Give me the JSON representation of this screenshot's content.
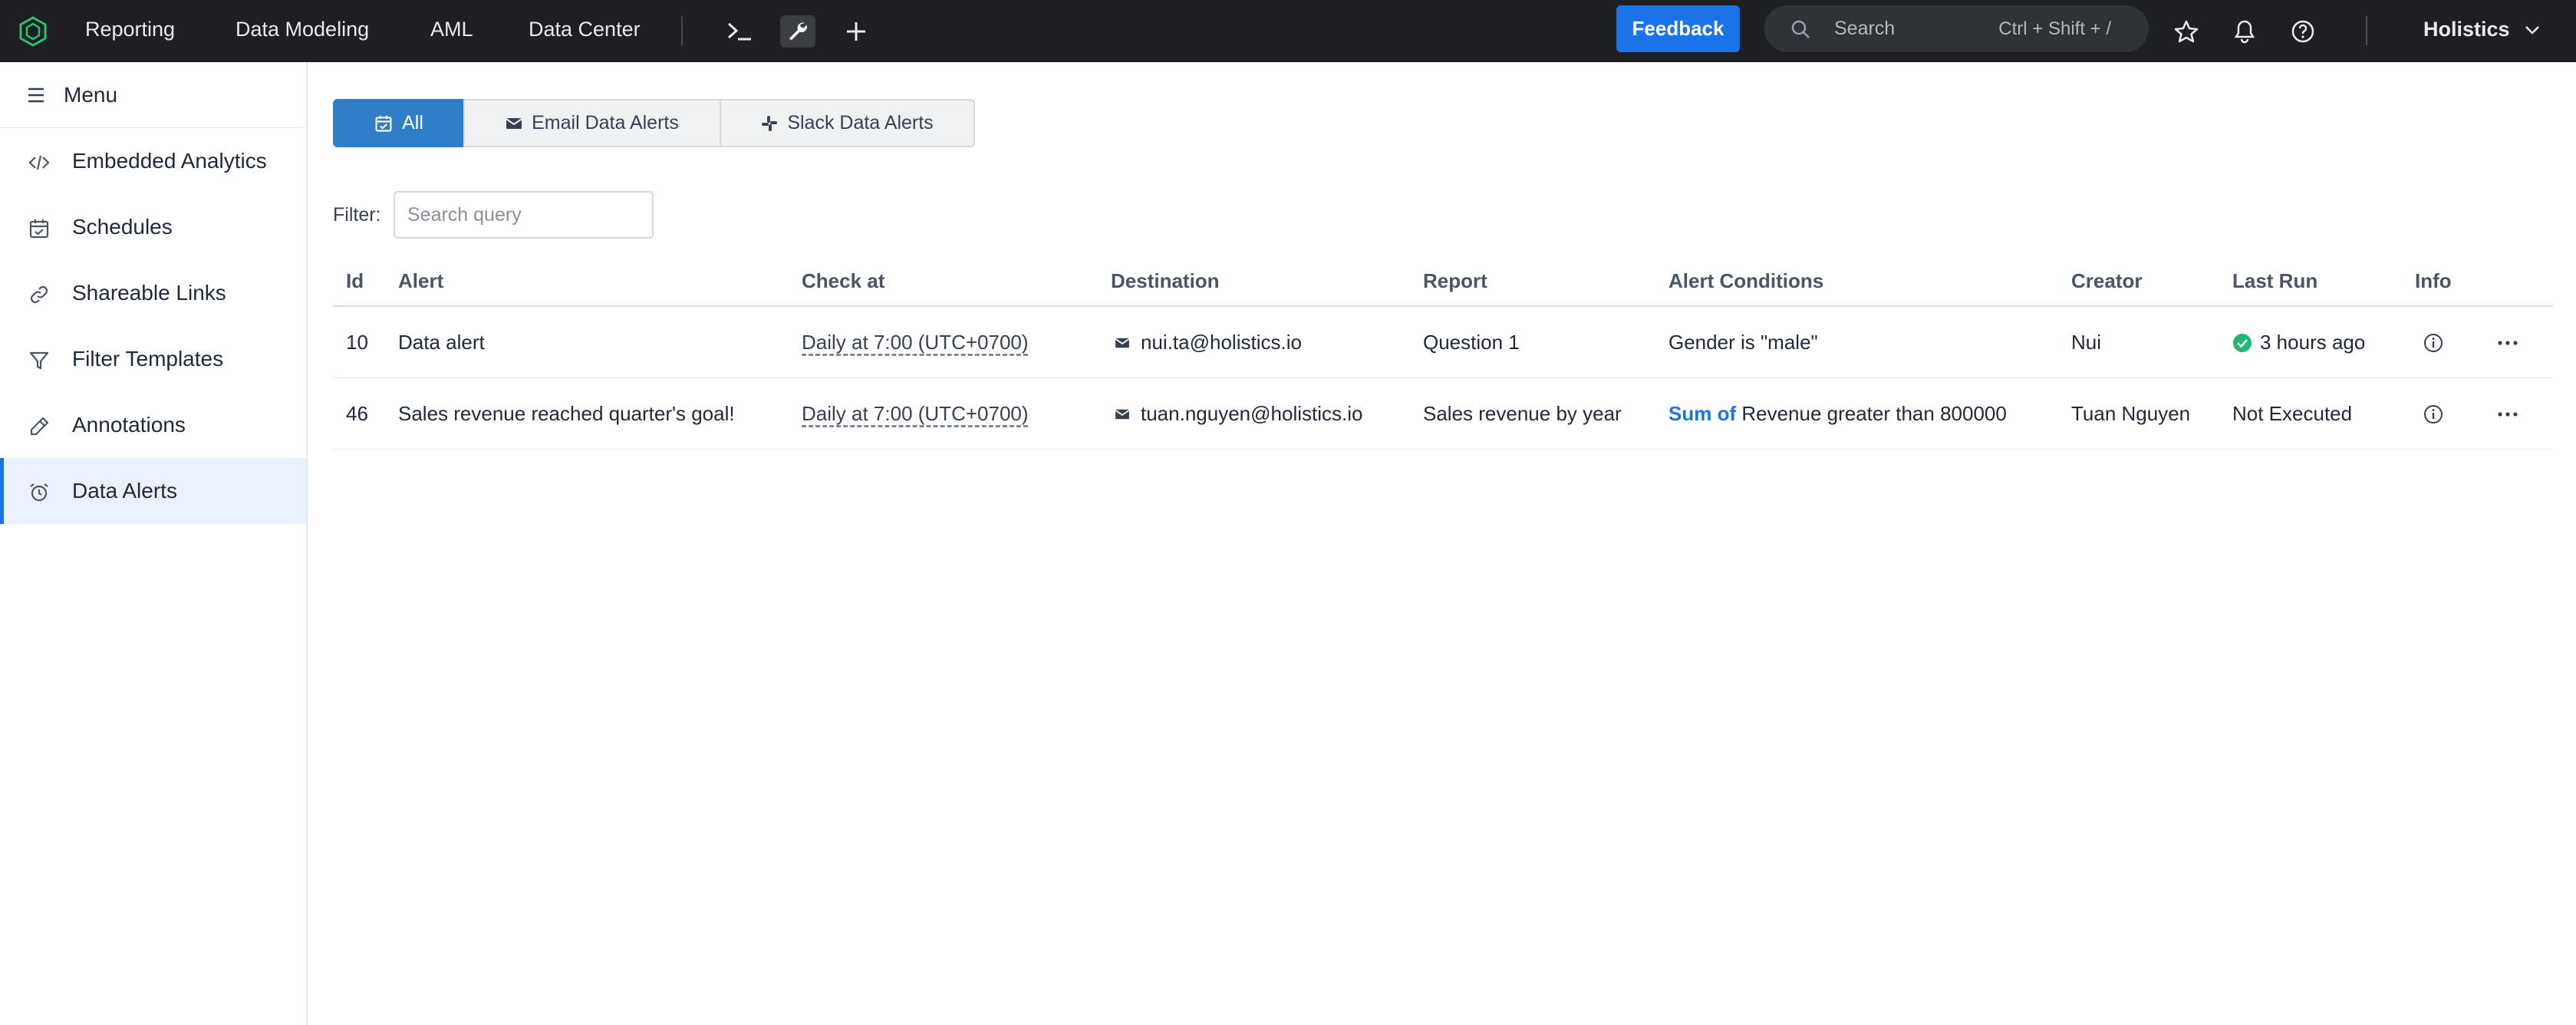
{
  "topbar": {
    "nav": [
      "Reporting",
      "Data Modeling",
      "AML",
      "Data Center"
    ],
    "feedback_label": "Feedback",
    "search_placeholder": "Search",
    "search_shortcut": "Ctrl + Shift + /",
    "workspace_name": "Holistics",
    "icons": [
      "holistics-logo-icon",
      "terminal-icon",
      "wrench-icon",
      "plus-icon",
      "star-icon",
      "bell-icon",
      "help-icon",
      "chevron-down-icon"
    ],
    "colors": {
      "bar": "#1d1f22",
      "accent": "#1a73e8"
    }
  },
  "sidebar": {
    "menu_label": "Menu",
    "items": [
      {
        "label": "Embedded Analytics",
        "icon": "code-icon"
      },
      {
        "label": "Schedules",
        "icon": "calendar-check-icon"
      },
      {
        "label": "Shareable Links",
        "icon": "link-icon"
      },
      {
        "label": "Filter Templates",
        "icon": "filter-icon"
      },
      {
        "label": "Annotations",
        "icon": "pencil-icon"
      },
      {
        "label": "Data Alerts",
        "icon": "alarm-icon",
        "active": true
      }
    ]
  },
  "tabs": [
    {
      "label": "All",
      "icon": "calendar-check-icon",
      "active": true
    },
    {
      "label": "Email Data Alerts",
      "icon": "envelope-icon"
    },
    {
      "label": "Slack Data Alerts",
      "icon": "slack-icon"
    }
  ],
  "filter": {
    "label": "Filter:",
    "placeholder": "Search query"
  },
  "table": {
    "columns": [
      "Id",
      "Alert",
      "Check at",
      "Destination",
      "Report",
      "Alert Conditions",
      "Creator",
      "Last Run",
      "Info"
    ],
    "rows": [
      {
        "id": "10",
        "alert": "Data alert",
        "check_at": "Daily at 7:00 (UTC+0700)",
        "destination": "nui.ta@holistics.io",
        "report": "Question 1",
        "condition_prefix": "",
        "condition": "Gender is \"male\"",
        "creator": "Nui",
        "last_run": "3 hours ago",
        "last_run_status": "success"
      },
      {
        "id": "46",
        "alert": "Sales revenue reached quarter's goal!",
        "check_at": "Daily at 7:00 (UTC+0700)",
        "destination": "tuan.nguyen@holistics.io",
        "report": "Sales revenue by year",
        "condition_prefix": "Sum of",
        "condition": "Revenue greater than 800000",
        "creator": "Tuan Nguyen",
        "last_run": "Not Executed",
        "last_run_status": "none"
      }
    ]
  }
}
